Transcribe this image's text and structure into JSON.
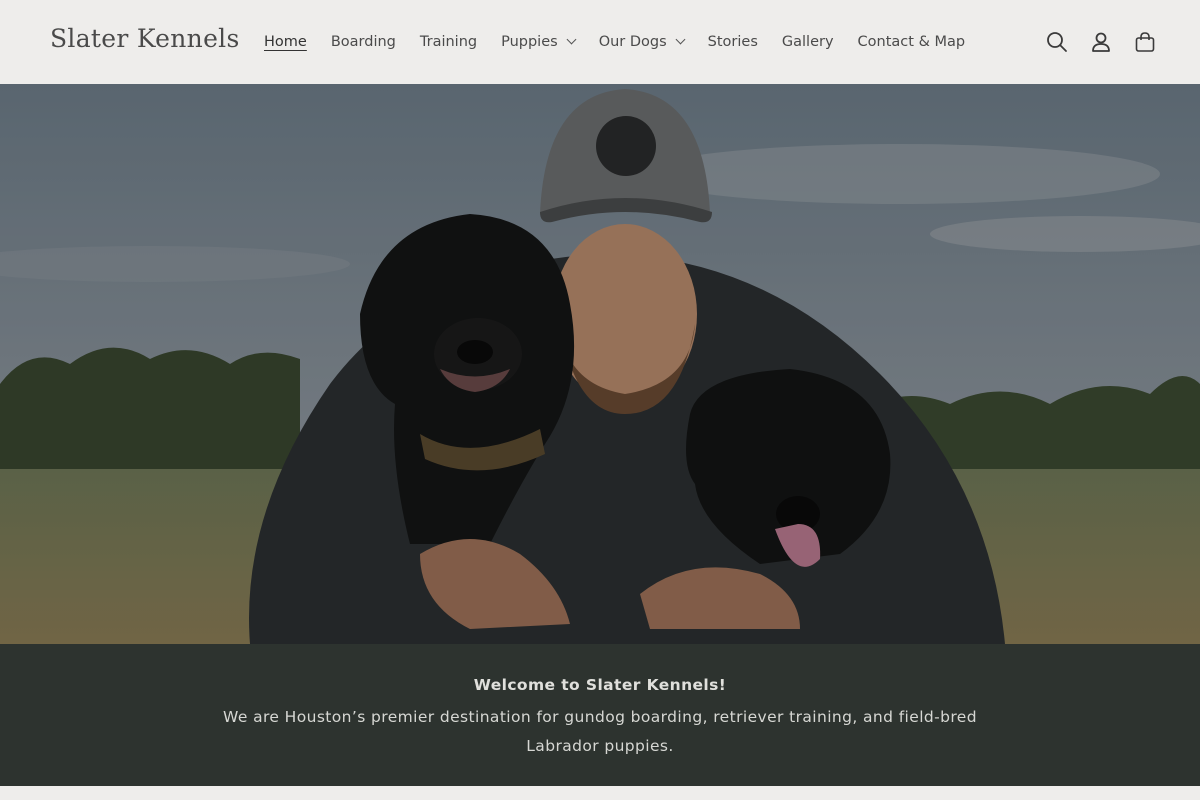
{
  "header": {
    "logo": "Slater Kennels",
    "nav": [
      {
        "label": "Home",
        "active": true,
        "dropdown": false
      },
      {
        "label": "Boarding",
        "active": false,
        "dropdown": false
      },
      {
        "label": "Training",
        "active": false,
        "dropdown": false
      },
      {
        "label": "Puppies",
        "active": false,
        "dropdown": true
      },
      {
        "label": "Our Dogs",
        "active": false,
        "dropdown": true
      },
      {
        "label": "Stories",
        "active": false,
        "dropdown": false
      },
      {
        "label": "Gallery",
        "active": false,
        "dropdown": false
      },
      {
        "label": "Contact & Map",
        "active": false,
        "dropdown": false
      }
    ],
    "icons": [
      "search-icon",
      "account-icon",
      "cart-icon"
    ]
  },
  "welcome": {
    "title": "Welcome to Slater Kennels!",
    "body": "We are Houston’s premier destination for gundog boarding, retriever training, and field-bred Labrador puppies."
  },
  "colors": {
    "header_bg": "#eeedeb",
    "welcome_bg": "#2d332f",
    "text": "#4b4b4b"
  }
}
